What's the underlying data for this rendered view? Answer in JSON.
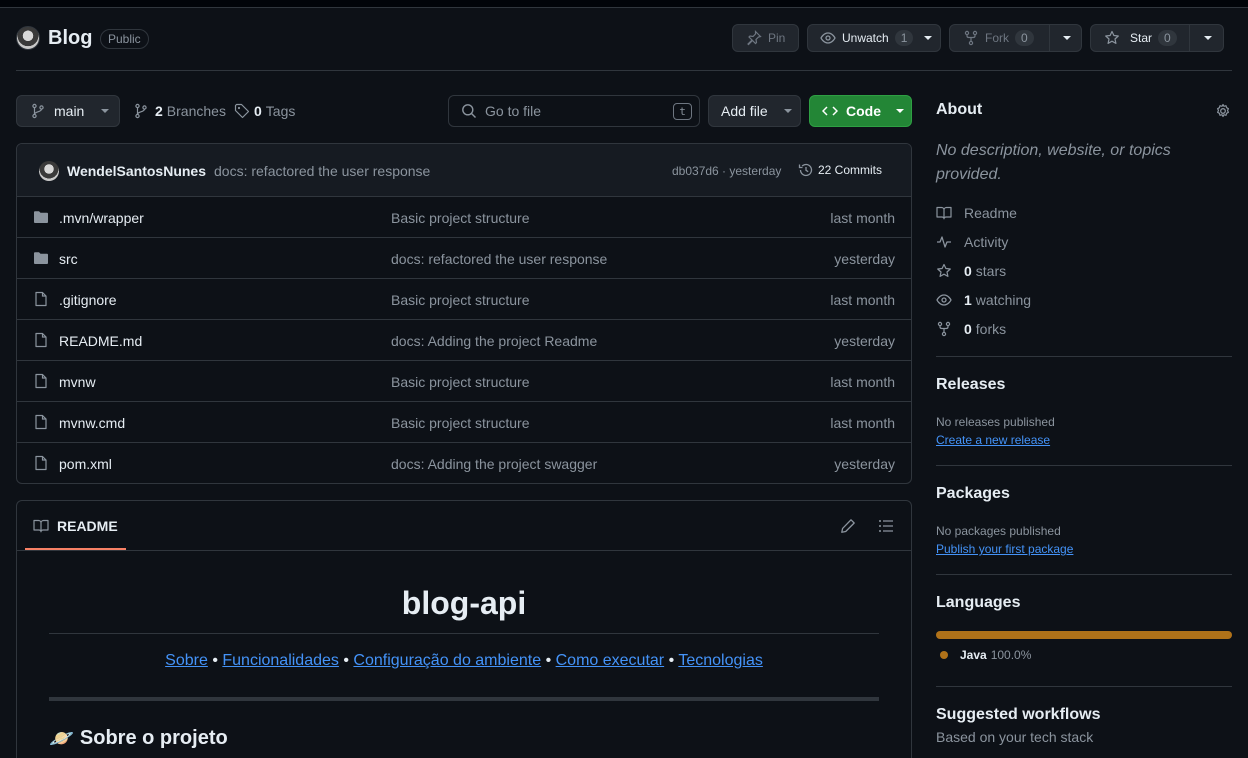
{
  "repo": {
    "name": "Blog",
    "visibility": "Public"
  },
  "header_actions": {
    "pin": "Pin",
    "unwatch": "Unwatch",
    "watch_count": "1",
    "fork": "Fork",
    "fork_count": "0",
    "star": "Star",
    "star_count": "0"
  },
  "toolbar": {
    "branch": "main",
    "branches_count": "2",
    "branches_label": "Branches",
    "tags_count": "0",
    "tags_label": "Tags",
    "goto_placeholder": "Go to file",
    "goto_shortcut": "t",
    "add_file": "Add file",
    "code": "Code"
  },
  "latest_commit": {
    "author": "WendelSantosNunes",
    "message": "docs: refactored the user response",
    "hash_time": "db037d6 · yesterday",
    "commits": "22 Commits"
  },
  "files": [
    {
      "type": "dir",
      "name": ".mvn/wrapper",
      "message": "Basic project structure",
      "date": "last month"
    },
    {
      "type": "dir",
      "name": "src",
      "message": "docs: refactored the user response",
      "date": "yesterday"
    },
    {
      "type": "file",
      "name": ".gitignore",
      "message": "Basic project structure",
      "date": "last month"
    },
    {
      "type": "file",
      "name": "README.md",
      "message": "docs: Adding the project Readme",
      "date": "yesterday"
    },
    {
      "type": "file",
      "name": "mvnw",
      "message": "Basic project structure",
      "date": "last month"
    },
    {
      "type": "file",
      "name": "mvnw.cmd",
      "message": "Basic project structure",
      "date": "last month"
    },
    {
      "type": "file",
      "name": "pom.xml",
      "message": "docs: Adding the project swagger",
      "date": "yesterday"
    }
  ],
  "readme": {
    "tab": "README",
    "title": "blog-api",
    "links": [
      "Sobre",
      "Funcionalidades",
      "Configuração do ambiente",
      "Como executar",
      "Tecnologias"
    ],
    "separator": "•",
    "section_emoji": "🪐",
    "section_heading": "Sobre o projeto"
  },
  "sidebar": {
    "about_title": "About",
    "about_desc": "No description, website, or topics provided.",
    "readme": "Readme",
    "activity": "Activity",
    "stars_count": "0",
    "stars_label": "stars",
    "watching_count": "1",
    "watching_label": "watching",
    "forks_count": "0",
    "forks_label": "forks",
    "releases_title": "Releases",
    "releases_text": "No releases published",
    "releases_link": "Create a new release",
    "packages_title": "Packages",
    "packages_text": "No packages published",
    "packages_link": "Publish your first package",
    "languages_title": "Languages",
    "language_name": "Java",
    "language_percent": "100.0%",
    "workflows_title": "Suggested workflows",
    "workflows_text": "Based on your tech stack"
  },
  "colors": {
    "background": "#0d1117",
    "border": "#30363d",
    "muted": "#8b949e",
    "link": "#4493f8",
    "code_button": "#238636",
    "java": "#b07219",
    "tab_underline": "#f78166"
  }
}
